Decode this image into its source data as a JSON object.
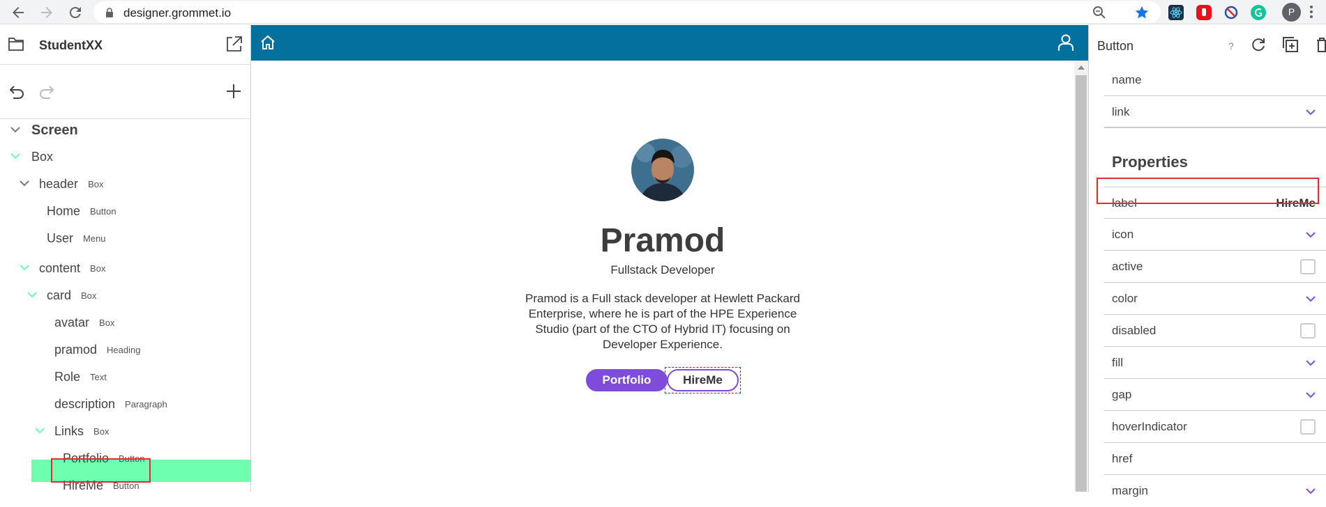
{
  "browser": {
    "url": "designer.grommet.io",
    "profile_initial": "P",
    "colors": {
      "star": "#1a73e8"
    }
  },
  "left_panel": {
    "project_name": "StudentXX",
    "tree": [
      {
        "name": "Screen",
        "type": ""
      },
      {
        "name": "Box",
        "type": ""
      },
      {
        "name": "header",
        "type": "Box"
      },
      {
        "name": "Home",
        "type": "Button"
      },
      {
        "name": "User",
        "type": "Menu"
      },
      {
        "name": "content",
        "type": "Box"
      },
      {
        "name": "card",
        "type": "Box"
      },
      {
        "name": "avatar",
        "type": "Box"
      },
      {
        "name": "pramod",
        "type": "Heading"
      },
      {
        "name": "Role",
        "type": "Text"
      },
      {
        "name": "description",
        "type": "Paragraph"
      },
      {
        "name": "Links",
        "type": "Box"
      },
      {
        "name": "Portfolio",
        "type": "Button"
      },
      {
        "name": "HireMe",
        "type": "Button"
      }
    ],
    "selected": "HireMe",
    "colors": {
      "selected_bg": "#6fffb0",
      "chevron": "#6fffb0",
      "highlight": "#e02c2c"
    }
  },
  "canvas": {
    "header_color": "#03719e",
    "name": "Pramod",
    "role": "Fullstack Developer",
    "description_lines": [
      "Pramod is a Full stack developer at Hewlett Packard",
      "Enterprise, where he is part of the HPE Experience",
      "Studio (part of the CTO of Hybrid IT) focusing on",
      "Developer Experience."
    ],
    "buttons": {
      "portfolio": "Portfolio",
      "hireme": "HireMe"
    },
    "accent": "#7d4cdb"
  },
  "right_panel": {
    "component": "Button",
    "help": "?",
    "top_props": [
      {
        "label": "name",
        "control": "none"
      },
      {
        "label": "link",
        "control": "dropdown"
      }
    ],
    "section": "Properties",
    "props": [
      {
        "label": "label",
        "value": "HireMe",
        "control": "text"
      },
      {
        "label": "icon",
        "control": "dropdown"
      },
      {
        "label": "active",
        "control": "checkbox"
      },
      {
        "label": "color",
        "control": "dropdown"
      },
      {
        "label": "disabled",
        "control": "checkbox"
      },
      {
        "label": "fill",
        "control": "dropdown"
      },
      {
        "label": "gap",
        "control": "dropdown"
      },
      {
        "label": "hoverIndicator",
        "control": "checkbox"
      },
      {
        "label": "href",
        "control": "none"
      },
      {
        "label": "margin",
        "control": "dropdown"
      }
    ]
  }
}
